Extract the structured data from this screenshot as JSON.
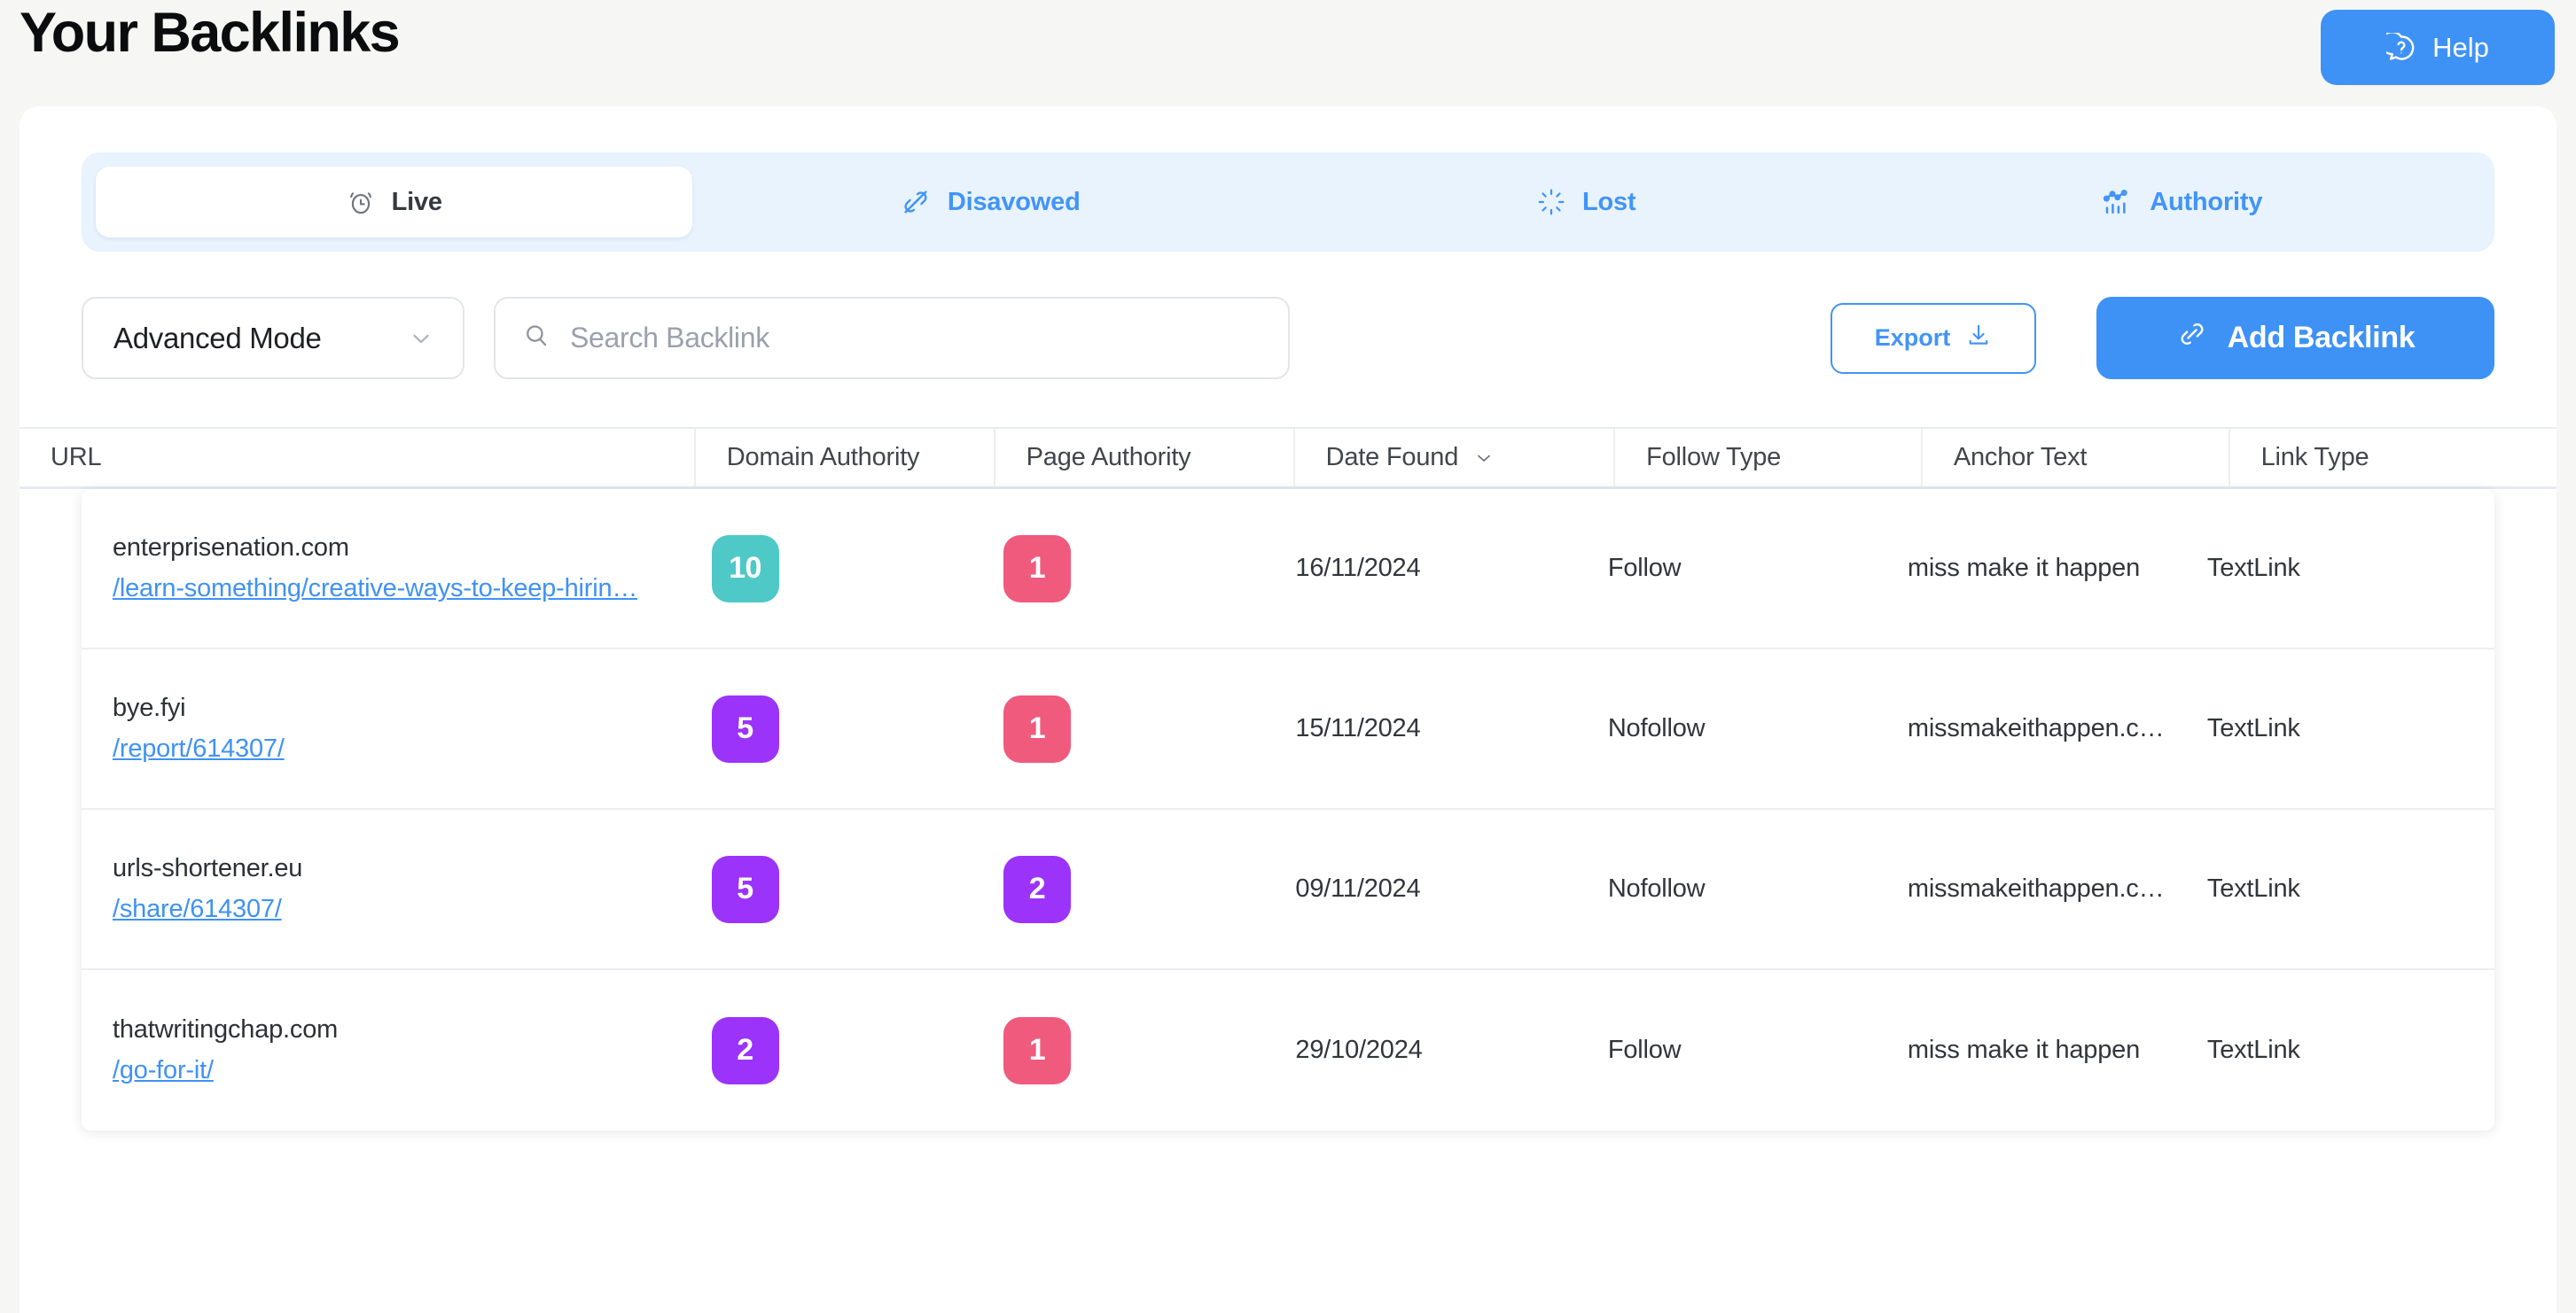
{
  "header": {
    "title": "Your Backlinks",
    "help_label": "Help",
    "help_icon": "question-speech-bubble-icon"
  },
  "tabs": [
    {
      "id": "live",
      "label": "Live",
      "icon": "alarm-clock-icon",
      "active": true
    },
    {
      "id": "disavowed",
      "label": "Disavowed",
      "icon": "broken-link-icon",
      "active": false
    },
    {
      "id": "lost",
      "label": "Lost",
      "icon": "sunburst-icon",
      "active": false
    },
    {
      "id": "authority",
      "label": "Authority",
      "icon": "line-chart-icon",
      "active": false
    }
  ],
  "toolbar": {
    "mode_value": "Advanced Mode",
    "mode_icon": "chevron-down-icon",
    "search_placeholder": "Search Backlink",
    "search_value": "",
    "search_icon": "search-icon",
    "export_label": "Export",
    "export_icon": "download-icon",
    "add_backlink_label": "Add Backlink",
    "add_backlink_icon": "link-icon"
  },
  "table": {
    "columns": [
      {
        "key": "url",
        "label": "URL",
        "sort_icon": ""
      },
      {
        "key": "da",
        "label": "Domain Authority",
        "sort_icon": ""
      },
      {
        "key": "pa",
        "label": "Page Authority",
        "sort_icon": ""
      },
      {
        "key": "date",
        "label": "Date Found",
        "sort_icon": "chevron-down-icon"
      },
      {
        "key": "follow",
        "label": "Follow Type",
        "sort_icon": ""
      },
      {
        "key": "anchor",
        "label": "Anchor Text",
        "sort_icon": ""
      },
      {
        "key": "link",
        "label": "Link Type",
        "sort_icon": ""
      }
    ],
    "rows": [
      {
        "domain": "enterprisenation.com",
        "path": "/learn-something/creative-ways-to-keep-hirin…",
        "domain_authority": "10",
        "domain_authority_color": "#4ec9c8",
        "page_authority": "1",
        "page_authority_color": "#ef5a7d",
        "date_found": "16/11/2024",
        "follow_type": "Follow",
        "anchor_text": "miss make it happen",
        "link_type": "TextLink"
      },
      {
        "domain": "bye.fyi",
        "path": "/report/614307/",
        "domain_authority": "5",
        "domain_authority_color": "#9b33fb",
        "page_authority": "1",
        "page_authority_color": "#ef5a7d",
        "date_found": "15/11/2024",
        "follow_type": "Nofollow",
        "anchor_text": "missmakeithappen.c…",
        "link_type": "TextLink"
      },
      {
        "domain": "urls-shortener.eu",
        "path": "/share/614307/",
        "domain_authority": "5",
        "domain_authority_color": "#9b33fb",
        "page_authority": "2",
        "page_authority_color": "#9b33fb",
        "date_found": "09/11/2024",
        "follow_type": "Nofollow",
        "anchor_text": "missmakeithappen.c…",
        "link_type": "TextLink"
      },
      {
        "domain": "thatwritingchap.com",
        "path": "/go-for-it/",
        "domain_authority": "2",
        "domain_authority_color": "#9b33fb",
        "page_authority": "1",
        "page_authority_color": "#ef5a7d",
        "date_found": "29/10/2024",
        "follow_type": "Follow",
        "anchor_text": "miss make it happen",
        "link_type": "TextLink"
      }
    ]
  },
  "colors": {
    "accent": "#3f92f5",
    "tab_bg": "#e8f3fe",
    "page_bg": "#f6f6f5",
    "teal": "#4ec9c8",
    "purple": "#9b33fb",
    "pink": "#ef5a7d"
  }
}
